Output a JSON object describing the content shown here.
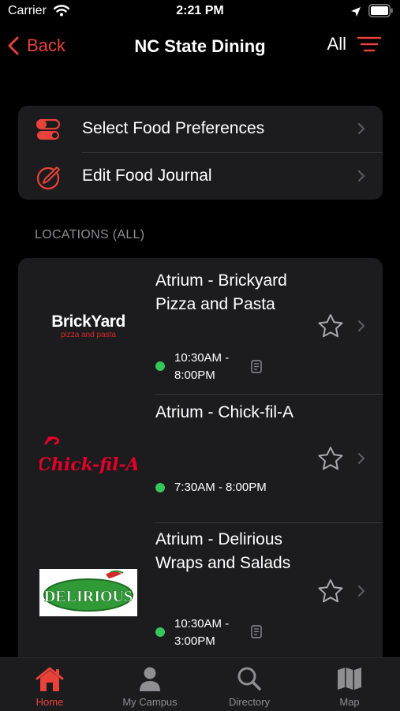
{
  "status_bar": {
    "carrier": "Carrier",
    "time": "2:21 PM"
  },
  "nav": {
    "back_label": "Back",
    "title": "NC State Dining",
    "filter_label": "All"
  },
  "preferences": [
    {
      "label": "Select Food Preferences",
      "icon": "toggles-icon"
    },
    {
      "label": "Edit Food Journal",
      "icon": "edit-journal-icon"
    }
  ],
  "locations_header": "LOCATIONS (ALL)",
  "locations": [
    {
      "name": "Atrium - Brickyard Pizza and Pasta",
      "hours": "10:30AM - 8:00PM",
      "logo_text": "BrickYard",
      "logo_subtext": "pizza and pasta",
      "open": true,
      "has_menu_note": true,
      "favorite": false
    },
    {
      "name": "Atrium - Chick-fil-A",
      "hours": "7:30AM - 8:00PM",
      "logo_text": "Chick-fil-A",
      "open": true,
      "has_menu_note": false,
      "favorite": false
    },
    {
      "name": "Atrium - Delirious Wraps and Salads",
      "hours": "10:30AM - 3:00PM",
      "logo_text": "DELIRIOUS",
      "open": true,
      "has_menu_note": true,
      "favorite": false
    }
  ],
  "tabs": [
    {
      "label": "Home",
      "icon": "home-icon",
      "active": true
    },
    {
      "label": "My Campus",
      "icon": "person-icon",
      "active": false
    },
    {
      "label": "Directory",
      "icon": "magnifier-icon",
      "active": false
    },
    {
      "label": "Map",
      "icon": "map-icon",
      "active": false
    }
  ],
  "colors": {
    "accent": "#e8423a",
    "background": "#000000",
    "card": "#1c1c1e",
    "open_dot": "#34c759",
    "secondary_text": "#8e8e93"
  }
}
